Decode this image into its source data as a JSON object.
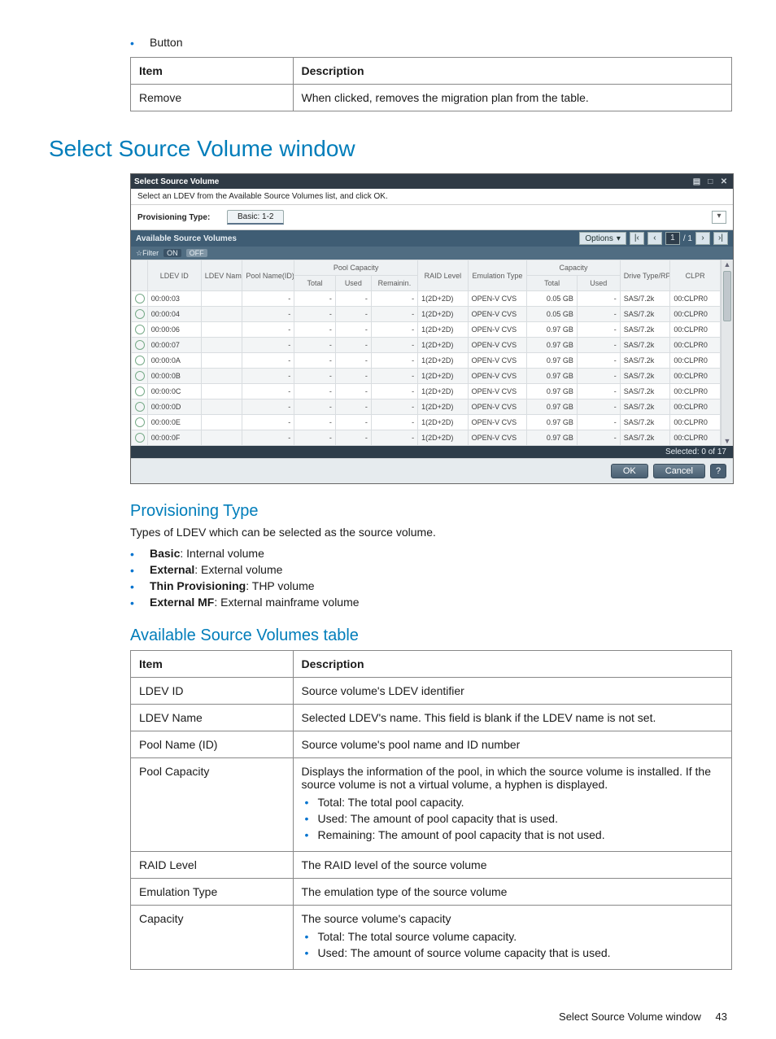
{
  "top_bullet": "Button",
  "button_table": {
    "headers": [
      "Item",
      "Description"
    ],
    "rows": [
      {
        "item": "Remove",
        "desc": "When clicked, removes the migration plan from the table."
      }
    ]
  },
  "heading_main": "Select Source Volume window",
  "screenshot": {
    "titlebar": "Select Source Volume",
    "instruction": "Select an LDEV from the Available Source Volumes list, and click OK.",
    "prov_label": "Provisioning Type:",
    "prov_tab": "Basic: 1-2",
    "section_title": "Available Source Volumes",
    "filter": {
      "label": "☆Filter",
      "on": "ON",
      "off": "OFF"
    },
    "options_label": "Options",
    "page_current": "1",
    "page_total": "/ 1",
    "headers_group": {
      "pool_capacity": "Pool Capacity",
      "capacity": "Capacity"
    },
    "headers": [
      "",
      "LDEV ID",
      "LDEV Name",
      "Pool Name(ID)",
      "Total",
      "Used",
      "Remainin.",
      "RAID Level",
      "Emulation Type",
      "Total",
      "Used",
      "Drive Type/RPM",
      "CLPR"
    ],
    "rows": [
      {
        "id": "00:00:03",
        "pool": "-",
        "pt": "-",
        "pu": "-",
        "pr": "-",
        "raid": "1(2D+2D)",
        "emu": "OPEN-V CVS",
        "ct": "0.05 GB",
        "cu": "-",
        "drv": "SAS/7.2k",
        "clpr": "00:CLPR0"
      },
      {
        "id": "00:00:04",
        "pool": "-",
        "pt": "-",
        "pu": "-",
        "pr": "-",
        "raid": "1(2D+2D)",
        "emu": "OPEN-V CVS",
        "ct": "0.05 GB",
        "cu": "-",
        "drv": "SAS/7.2k",
        "clpr": "00:CLPR0"
      },
      {
        "id": "00:00:06",
        "pool": "-",
        "pt": "-",
        "pu": "-",
        "pr": "-",
        "raid": "1(2D+2D)",
        "emu": "OPEN-V CVS",
        "ct": "0.97 GB",
        "cu": "-",
        "drv": "SAS/7.2k",
        "clpr": "00:CLPR0"
      },
      {
        "id": "00:00:07",
        "pool": "-",
        "pt": "-",
        "pu": "-",
        "pr": "-",
        "raid": "1(2D+2D)",
        "emu": "OPEN-V CVS",
        "ct": "0.97 GB",
        "cu": "-",
        "drv": "SAS/7.2k",
        "clpr": "00:CLPR0"
      },
      {
        "id": "00:00:0A",
        "pool": "-",
        "pt": "-",
        "pu": "-",
        "pr": "-",
        "raid": "1(2D+2D)",
        "emu": "OPEN-V CVS",
        "ct": "0.97 GB",
        "cu": "-",
        "drv": "SAS/7.2k",
        "clpr": "00:CLPR0"
      },
      {
        "id": "00:00:0B",
        "pool": "-",
        "pt": "-",
        "pu": "-",
        "pr": "-",
        "raid": "1(2D+2D)",
        "emu": "OPEN-V CVS",
        "ct": "0.97 GB",
        "cu": "-",
        "drv": "SAS/7.2k",
        "clpr": "00:CLPR0"
      },
      {
        "id": "00:00:0C",
        "pool": "-",
        "pt": "-",
        "pu": "-",
        "pr": "-",
        "raid": "1(2D+2D)",
        "emu": "OPEN-V CVS",
        "ct": "0.97 GB",
        "cu": "-",
        "drv": "SAS/7.2k",
        "clpr": "00:CLPR0"
      },
      {
        "id": "00:00:0D",
        "pool": "-",
        "pt": "-",
        "pu": "-",
        "pr": "-",
        "raid": "1(2D+2D)",
        "emu": "OPEN-V CVS",
        "ct": "0.97 GB",
        "cu": "-",
        "drv": "SAS/7.2k",
        "clpr": "00:CLPR0"
      },
      {
        "id": "00:00:0E",
        "pool": "-",
        "pt": "-",
        "pu": "-",
        "pr": "-",
        "raid": "1(2D+2D)",
        "emu": "OPEN-V CVS",
        "ct": "0.97 GB",
        "cu": "-",
        "drv": "SAS/7.2k",
        "clpr": "00:CLPR0"
      },
      {
        "id": "00:00:0F",
        "pool": "-",
        "pt": "-",
        "pu": "-",
        "pr": "-",
        "raid": "1(2D+2D)",
        "emu": "OPEN-V CVS",
        "ct": "0.97 GB",
        "cu": "-",
        "drv": "SAS/7.2k",
        "clpr": "00:CLPR0"
      }
    ],
    "status": "Selected:  0   of  17",
    "ok_label": "OK",
    "cancel_label": "Cancel",
    "help_label": "?"
  },
  "provisioning": {
    "heading": "Provisioning Type",
    "lead": "Types of LDEV which can be selected as the source volume.",
    "items": [
      {
        "term": "Basic",
        "desc": ": Internal volume"
      },
      {
        "term": "External",
        "desc": ": External volume"
      },
      {
        "term": "Thin Provisioning",
        "desc": ": THP volume"
      },
      {
        "term": "External MF",
        "desc": ": External mainframe volume"
      }
    ]
  },
  "asv": {
    "heading": "Available Source Volumes table",
    "headers": [
      "Item",
      "Description"
    ],
    "rows": [
      {
        "item": "LDEV ID",
        "desc": "Source volume's LDEV identifier",
        "bullets": []
      },
      {
        "item": "LDEV Name",
        "desc": "Selected LDEV's name. This field is blank if the LDEV name is not set.",
        "bullets": []
      },
      {
        "item": "Pool Name (ID)",
        "desc": "Source volume's pool name and ID number",
        "bullets": []
      },
      {
        "item": "Pool Capacity",
        "desc": "Displays the information of the pool, in which the source volume is installed. If the source volume is not a virtual volume, a hyphen is displayed.",
        "bullets": [
          "Total: The total pool capacity.",
          "Used: The amount of pool capacity that is used.",
          "Remaining: The amount of pool capacity that is not used."
        ]
      },
      {
        "item": "RAID Level",
        "desc": "The RAID level of the source volume",
        "bullets": []
      },
      {
        "item": "Emulation Type",
        "desc": "The emulation type of the source volume",
        "bullets": []
      },
      {
        "item": "Capacity",
        "desc": "The source volume's capacity",
        "bullets": [
          "Total: The total source volume capacity.",
          "Used: The amount of source volume capacity that is used."
        ]
      }
    ]
  },
  "footer": {
    "title": "Select Source Volume window",
    "page": "43"
  }
}
